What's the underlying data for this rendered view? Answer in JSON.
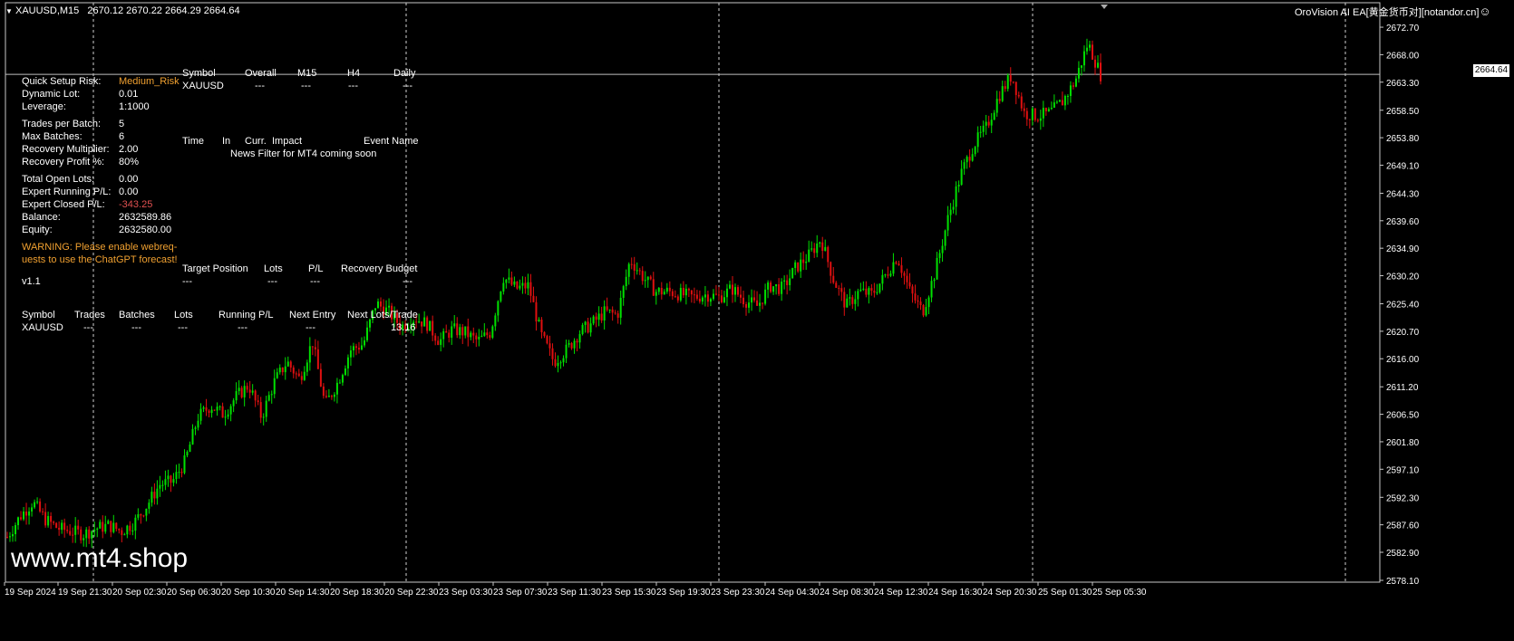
{
  "window": {
    "symbol_header": "XAUUSD,M15",
    "ohlc": "2670.12 2670.22 2664.29 2664.64",
    "ea_title": "OroVision AI EA[黄金货币对][notandor.cn]",
    "smiley": "☺"
  },
  "left_panel": {
    "settings": [
      {
        "label": "Quick Setup Risk:",
        "value": "Medium_Risk",
        "color": "#f0a030"
      },
      {
        "label": "Dynamic Lot:",
        "value": "0.01"
      },
      {
        "label": "Leverage:",
        "value": "1:1000"
      },
      {
        "label": "Trades per Batch:",
        "value": "5"
      },
      {
        "label": "Max Batches:",
        "value": "6"
      },
      {
        "label": "Recovery Multiplier:",
        "value": "2.00"
      },
      {
        "label": "Recovery Profit %:",
        "value": "80%"
      },
      {
        "label": "Total Open Lots:",
        "value": "0.00"
      },
      {
        "label": "Expert Running P/L:",
        "value": "0.00"
      },
      {
        "label": "Expert Closed P/L:",
        "value": "-343.25",
        "color": "#e05050"
      },
      {
        "label": "Balance:",
        "value": "2632589.86"
      },
      {
        "label": "Equity:",
        "value": "2632580.00"
      }
    ],
    "warning_line1": "WARNING: Please enable webreq-",
    "warning_line2": "uests to use the ChatGPT forecast!",
    "version": "v1.1"
  },
  "trend_table": {
    "headers": [
      "Symbol",
      "Overall",
      "M15",
      "H4",
      "Daily"
    ],
    "row": [
      "XAUUSD",
      "---",
      "---",
      "---",
      "---"
    ]
  },
  "news_table": {
    "headers": [
      "Time",
      "In",
      "Curr.",
      "Impact",
      "Event Name"
    ],
    "message": "News Filter for MT4 coming soon"
  },
  "target_table": {
    "headers": [
      "Target Position",
      "Lots",
      "P/L",
      "Recovery Budget"
    ],
    "row": [
      "---",
      "---",
      "---",
      "---"
    ]
  },
  "batch_table": {
    "headers": [
      "Symbol",
      "Trades",
      "Batches",
      "Lots",
      "Running P/L",
      "Next Entry",
      "Next Lots/Trade"
    ],
    "row": [
      "XAUUSD",
      "---",
      "---",
      "---",
      "---",
      "---",
      "13.16"
    ]
  },
  "watermark": "www.mt4.shop",
  "current_price_tag": "2664.64",
  "chart_data": {
    "type": "candlestick",
    "symbol": "XAUUSD",
    "timeframe": "M15",
    "ylim": [
      2578.1,
      2674.1
    ],
    "y_ticks": [
      "2672.70",
      "2668.00",
      "2663.30",
      "2658.50",
      "2653.80",
      "2649.10",
      "2644.30",
      "2639.60",
      "2634.90",
      "2630.20",
      "2625.40",
      "2620.70",
      "2616.00",
      "2611.20",
      "2606.50",
      "2601.80",
      "2597.10",
      "2592.30",
      "2587.60",
      "2582.90",
      "2578.10"
    ],
    "x_ticks": [
      "19 Sep 2024",
      "19 Sep 21:30",
      "20 Sep 02:30",
      "20 Sep 06:30",
      "20 Sep 10:30",
      "20 Sep 14:30",
      "20 Sep 18:30",
      "20 Sep 22:30",
      "23 Sep 03:30",
      "23 Sep 07:30",
      "23 Sep 11:30",
      "23 Sep 15:30",
      "23 Sep 19:30",
      "23 Sep 23:30",
      "24 Sep 04:30",
      "24 Sep 08:30",
      "24 Sep 12:30",
      "24 Sep 16:30",
      "24 Sep 20:30",
      "25 Sep 01:30",
      "25 Sep 05:30"
    ],
    "current_price": 2664.64,
    "price_path": [
      2585.5,
      2589.0,
      2591.5,
      2588.5,
      2587.0,
      2586.5,
      2586.0,
      2587.0,
      2587.5,
      2586.5,
      2588.0,
      2591.0,
      2594.5,
      2595.0,
      2598.5,
      2606.0,
      2608.0,
      2606.5,
      2609.5,
      2611.5,
      2606.0,
      2612.0,
      2615.5,
      2612.5,
      2619.0,
      2608.0,
      2612.0,
      2617.5,
      2618.5,
      2625.5,
      2624.0,
      2621.5,
      2623.0,
      2622.0,
      2619.0,
      2621.0,
      2620.5,
      2619.0,
      2620.5,
      2630.0,
      2628.0,
      2628.5,
      2620.0,
      2615.5,
      2617.5,
      2620.5,
      2622.0,
      2624.0,
      2623.5,
      2633.0,
      2630.0,
      2627.5,
      2627.5,
      2627.0,
      2626.5,
      2627.0,
      2626.5,
      2628.0,
      2626.0,
      2625.0,
      2628.5,
      2628.0,
      2631.5,
      2633.5,
      2636.5,
      2629.5,
      2625.0,
      2627.5,
      2627.0,
      2630.0,
      2633.5,
      2627.5,
      2624.0,
      2631.0,
      2640.0,
      2647.5,
      2652.5,
      2655.5,
      2661.0,
      2664.5,
      2658.0,
      2657.5,
      2658.0,
      2660.0,
      2663.5,
      2670.0,
      2664.6
    ]
  }
}
